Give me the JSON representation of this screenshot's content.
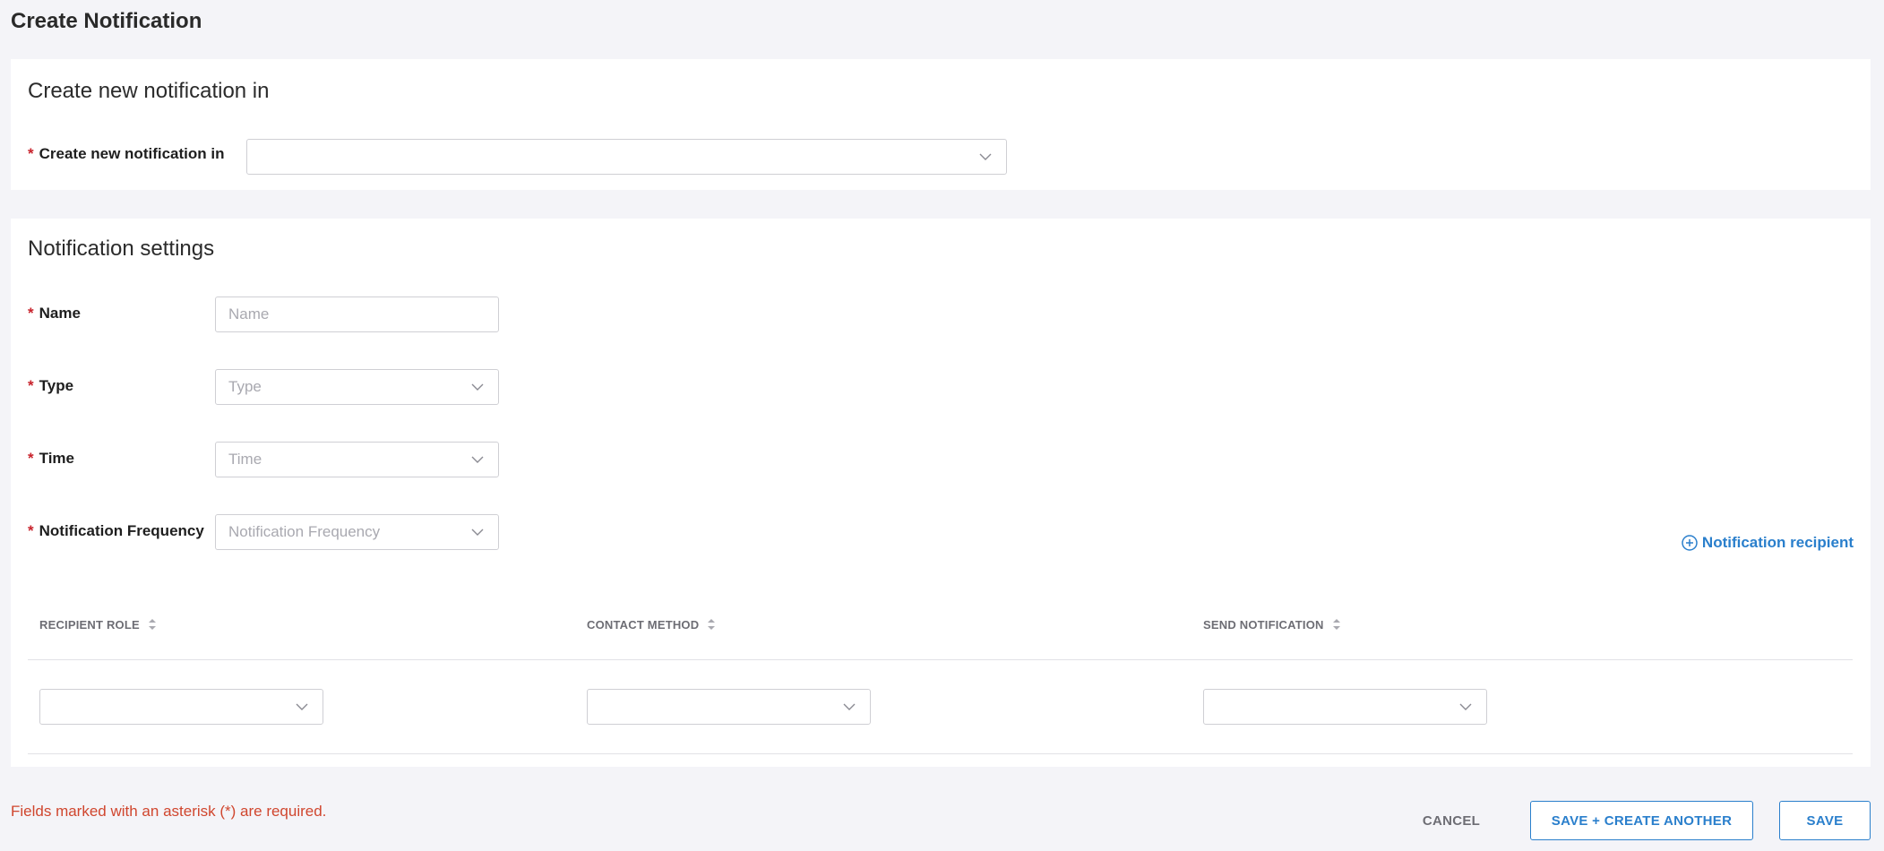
{
  "page": {
    "title": "Create Notification"
  },
  "location_section": {
    "title": "Create new notification in",
    "field_label": "Create new notification in",
    "value": ""
  },
  "settings_section": {
    "title": "Notification settings",
    "fields": {
      "name": {
        "label": "Name",
        "placeholder": "Name"
      },
      "type": {
        "label": "Type",
        "placeholder": "Type"
      },
      "time": {
        "label": "Time",
        "placeholder": "Time"
      },
      "frequency": {
        "label": "Notification Frequency",
        "placeholder": "Notification Frequency"
      }
    },
    "required_marker": "*",
    "add_recipient_label": "Notification recipient"
  },
  "recipients_table": {
    "columns": [
      "RECIPIENT ROLE",
      "CONTACT METHOD",
      "SEND NOTIFICATION"
    ],
    "rows": [
      {
        "recipient_role": "",
        "contact_method": "",
        "send_notification": ""
      }
    ]
  },
  "footer": {
    "required_note": "Fields marked with an asterisk (*) are required.",
    "cancel_label": "CANCEL",
    "save_another_label": "SAVE + CREATE ANOTHER",
    "save_label": "SAVE"
  },
  "colors": {
    "accent": "#2a7fcc",
    "required": "#c8232c",
    "note": "#d0462e",
    "background": "#f4f4f8"
  },
  "icons": {
    "dropdown": "chevron-down-icon",
    "add": "plus-circle-icon",
    "sort": "sort-icon"
  }
}
